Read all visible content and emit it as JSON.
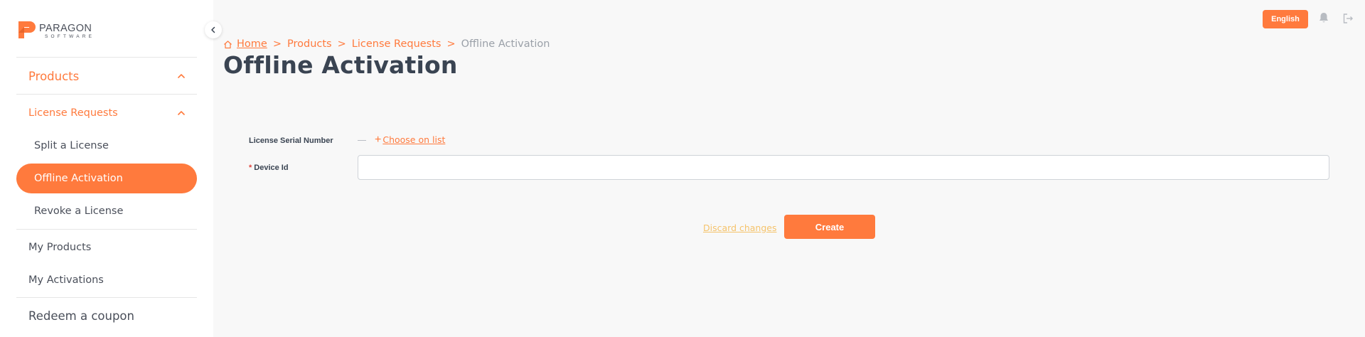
{
  "brand": {
    "name": "PARAGON",
    "subtitle": "SOFTWARE",
    "accent_color": "#ff7a3d"
  },
  "sidebar": {
    "products": {
      "label": "Products",
      "expanded": true
    },
    "license_requests": {
      "label": "License Requests",
      "expanded": true,
      "items": [
        {
          "label": "Split a License",
          "active": false
        },
        {
          "label": "Offline Activation",
          "active": true
        },
        {
          "label": "Revoke a License",
          "active": false
        }
      ]
    },
    "my_products": "My Products",
    "my_activations": "My Activations",
    "redeem": "Redeem a coupon"
  },
  "header": {
    "language": "English"
  },
  "breadcrumb": {
    "home": "Home",
    "separator": ">",
    "items": [
      "Products",
      "License Requests"
    ],
    "current": "Offline Activation"
  },
  "page": {
    "title": "Offline Activation"
  },
  "form": {
    "serial_label": "License Serial Number",
    "serial_value": "",
    "choose_link": "Choose on list",
    "device_label": "Device Id",
    "device_required_mark": "*",
    "device_value": "",
    "discard": "Discard changes",
    "create": "Create"
  }
}
